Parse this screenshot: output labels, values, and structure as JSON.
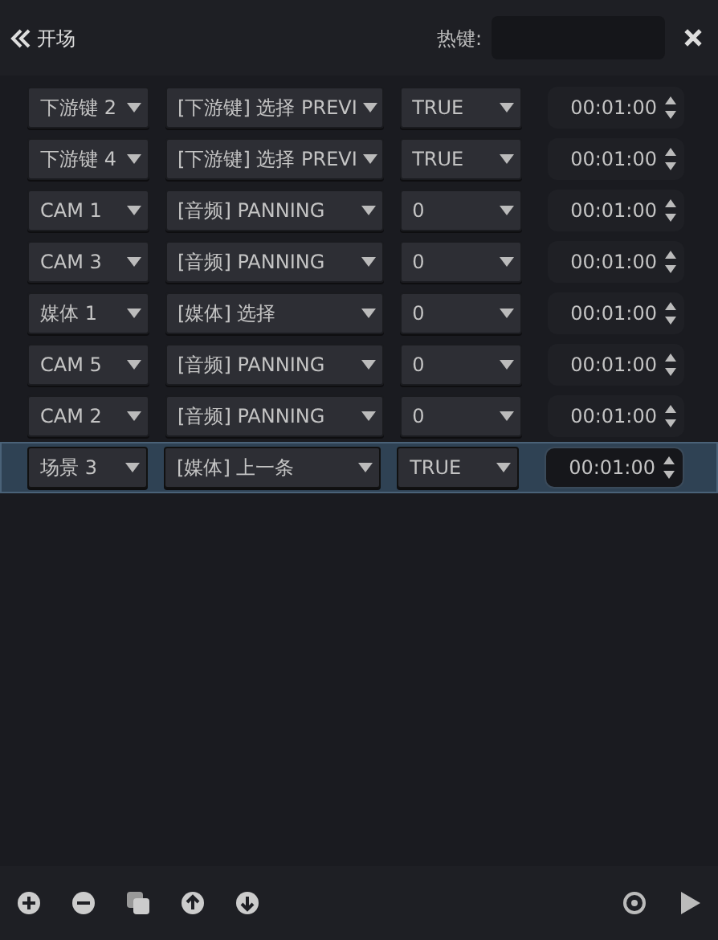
{
  "header": {
    "title": "开场",
    "hotkey_label": "热键:"
  },
  "rows": [
    {
      "source": "下游键 2",
      "action": "[下游键] 选择 PREVI",
      "value": "TRUE",
      "time": "00:01:00",
      "selected": false
    },
    {
      "source": "下游键 4",
      "action": "[下游键] 选择 PREVI",
      "value": "TRUE",
      "time": "00:01:00",
      "selected": false
    },
    {
      "source": "CAM 1",
      "action": "[音频] PANNING",
      "value": "0",
      "time": "00:01:00",
      "selected": false
    },
    {
      "source": "CAM 3",
      "action": "[音频] PANNING",
      "value": "0",
      "time": "00:01:00",
      "selected": false
    },
    {
      "source": "媒体 1",
      "action": "[媒体] 选择",
      "value": "0",
      "time": "00:01:00",
      "selected": false
    },
    {
      "source": "CAM 5",
      "action": "[音频] PANNING",
      "value": "0",
      "time": "00:01:00",
      "selected": false
    },
    {
      "source": "CAM 2",
      "action": "[音频] PANNING",
      "value": "0",
      "time": "00:01:00",
      "selected": false
    },
    {
      "source": "场景 3",
      "action": "[媒体] 上一条",
      "value": "TRUE",
      "time": "00:01:00",
      "selected": true
    }
  ],
  "toolbar": [
    {
      "kind": "add"
    },
    {
      "kind": "remove"
    },
    {
      "kind": "copy"
    },
    {
      "kind": "up"
    },
    {
      "kind": "down"
    },
    {
      "kind": "gap"
    },
    {
      "kind": "record"
    },
    {
      "kind": "play"
    }
  ]
}
